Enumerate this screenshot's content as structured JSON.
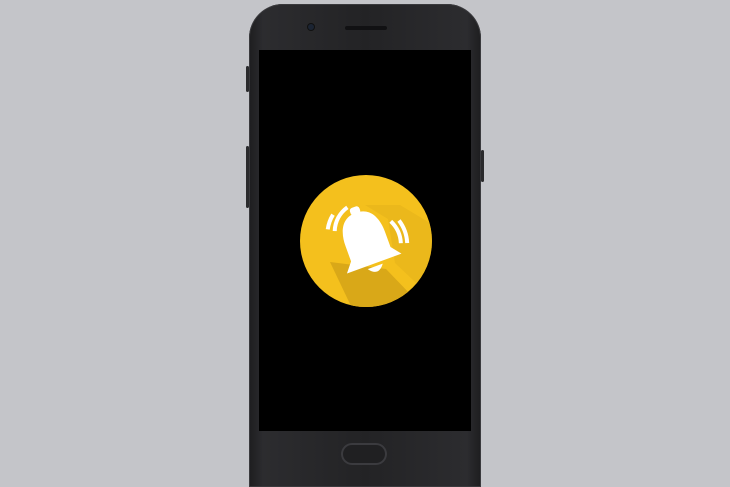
{
  "scene": {
    "background_color": "#c4c5c9",
    "device": "smartphone",
    "device_color": "#232325"
  },
  "screen": {
    "background_color": "#000000",
    "app_icon": {
      "icon": "bell-ringing-icon",
      "circle_color": "#f4c01d",
      "shadow_color": "#d9a818",
      "glyph_color": "#ffffff"
    }
  }
}
